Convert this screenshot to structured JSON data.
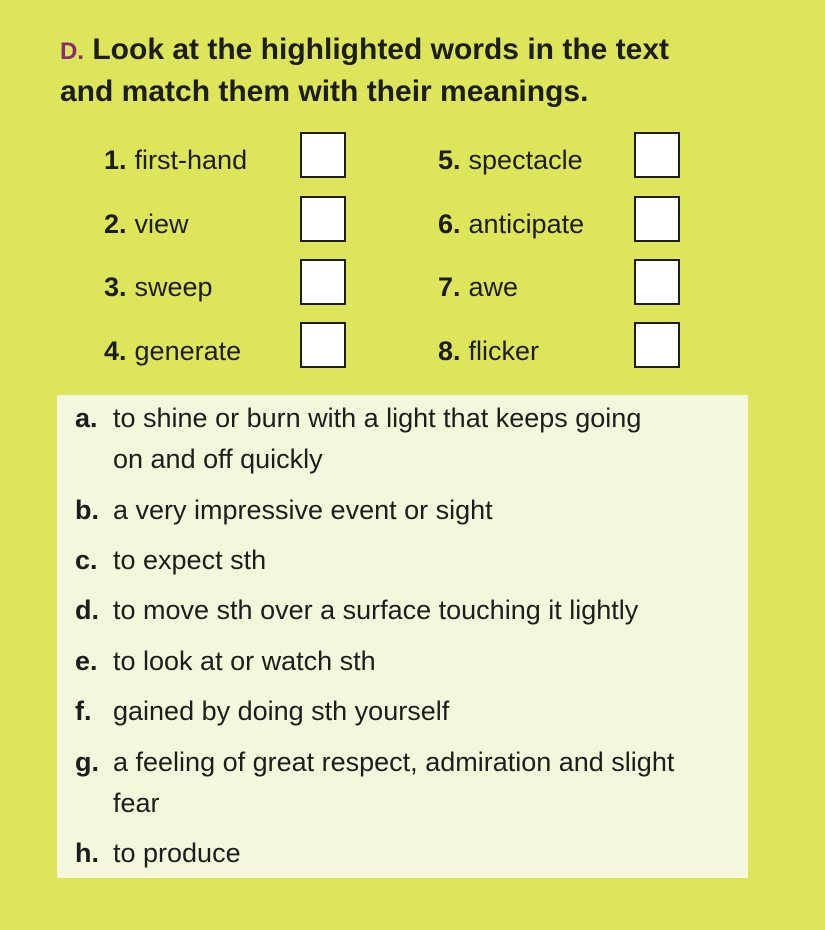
{
  "exercise": {
    "letter": "D.",
    "instruction_line1": "Look at the highlighted words in the text",
    "instruction_line2": "and match them with their meanings."
  },
  "words": [
    {
      "num": "1.",
      "word": "first-hand"
    },
    {
      "num": "2.",
      "word": "view"
    },
    {
      "num": "3.",
      "word": "sweep"
    },
    {
      "num": "4.",
      "word": "generate"
    },
    {
      "num": "5.",
      "word": "spectacle"
    },
    {
      "num": "6.",
      "word": "anticipate"
    },
    {
      "num": "7.",
      "word": "awe"
    },
    {
      "num": "8.",
      "word": "flicker"
    }
  ],
  "definitions": [
    {
      "letter": "a.",
      "text": "to shine or burn with a light that keeps going on and off quickly"
    },
    {
      "letter": "b.",
      "text": "a very impressive event or sight"
    },
    {
      "letter": "c.",
      "text": "to expect sth"
    },
    {
      "letter": "d.",
      "text": "to move sth over a surface touching it lightly"
    },
    {
      "letter": "e.",
      "text": "to look at or watch sth"
    },
    {
      "letter": "f.",
      "text": "gained by doing sth yourself"
    },
    {
      "letter": "g.",
      "text": "a feeling of great respect, admiration and slight fear"
    },
    {
      "letter": "h.",
      "text": "to produce"
    }
  ]
}
